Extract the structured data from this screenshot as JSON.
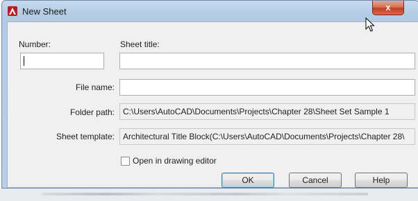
{
  "window": {
    "title": "New Sheet",
    "close_glyph": "x"
  },
  "icons": {
    "app": "autocad-logo-icon",
    "close": "close-icon",
    "cursor": "mouse-pointer-icon"
  },
  "form": {
    "number_label": "Number:",
    "number_value": "",
    "sheet_title_label": "Sheet title:",
    "sheet_title_value": "",
    "file_name_label": "File name:",
    "file_name_value": "",
    "folder_path_label": "Folder path:",
    "folder_path_value": "C:\\Users\\AutoCAD\\Documents\\Projects\\Chapter 28\\Sheet Set Sample 1",
    "sheet_template_label": "Sheet template:",
    "sheet_template_value": "Architectural Title Block(C:\\Users\\AutoCAD\\Documents\\Projects\\Chapter 28\\",
    "open_in_editor_label": "Open in drawing editor",
    "open_in_editor_checked": false
  },
  "buttons": {
    "ok": "OK",
    "cancel": "Cancel",
    "help": "Help"
  },
  "colors": {
    "title_bar": "#b9cfe7",
    "close_button": "#c2401f",
    "app_icon": "#c8161e",
    "dialog_bg": "#f0f0f0"
  }
}
